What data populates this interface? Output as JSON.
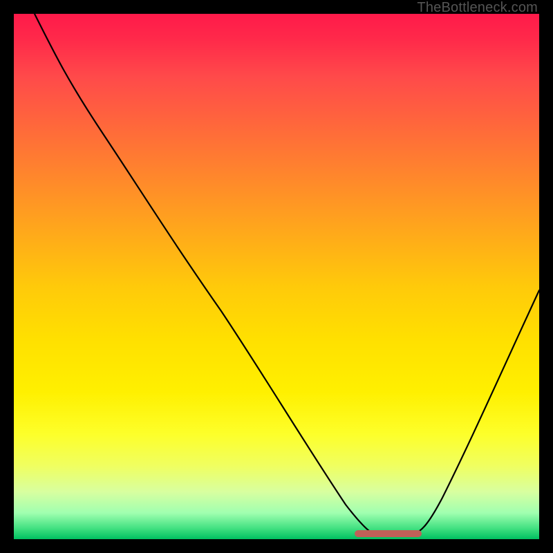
{
  "watermark": "TheBottleneck.com",
  "chart_data": {
    "type": "line",
    "title": "",
    "xlabel": "",
    "ylabel": "",
    "xlim": [
      0,
      100
    ],
    "ylim": [
      0,
      100
    ],
    "grid": false,
    "legend": false,
    "annotations": [],
    "background_gradient": {
      "top": "#ff1a4a",
      "mid": "#ffe000",
      "bottom": "#00c060",
      "meaning_top": "bad",
      "meaning_bottom": "good"
    },
    "series": [
      {
        "name": "bottleneck-curve",
        "color": "#000000",
        "x": [
          4,
          10,
          20,
          30,
          40,
          50,
          60,
          65,
          68,
          72,
          74,
          78,
          85,
          92,
          100
        ],
        "y": [
          100,
          91,
          77,
          63,
          49,
          34,
          18,
          9,
          3,
          2,
          2,
          3,
          14,
          30,
          48
        ]
      }
    ],
    "flat_segment": {
      "color": "#c06058",
      "x_start": 65,
      "x_end": 78,
      "y": 2
    }
  }
}
